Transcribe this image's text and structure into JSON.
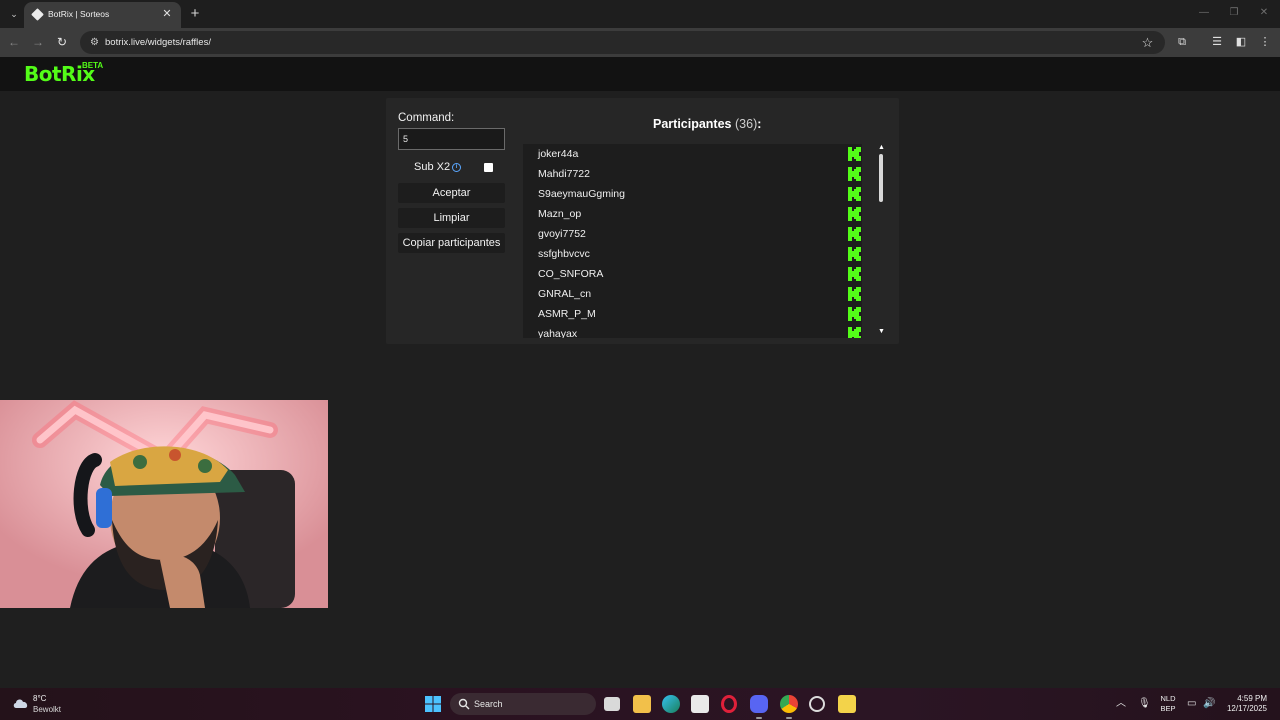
{
  "browser": {
    "tab_title": "BotRix | Sorteos",
    "url": "botrix.live/widgets/raffles/",
    "new_tab_symbol": "+",
    "close_symbol": "✕"
  },
  "site": {
    "logo": "BotRix",
    "beta": "BETA",
    "brand_color": "#53fc18"
  },
  "form": {
    "command_label": "Command:",
    "command_value": "5",
    "subx2_label": "Sub X2",
    "subx2_checked": false,
    "accept_label": "Aceptar",
    "clear_label": "Limpiar",
    "copy_label": "Copiar participantes"
  },
  "participants": {
    "title": "Participantes",
    "count": "(36)",
    "colon": ":",
    "names": [
      "joker44a",
      "Mahdi7722",
      "S9aeymauGgming",
      "Mazn_op",
      "gvoyi7752",
      "ssfghbvcvc",
      "CO_SNFORA",
      "GNRAL_cn",
      "ASMR_P_M",
      "yahayax"
    ],
    "platform_icon": "kick-icon"
  },
  "taskbar": {
    "temperature": "8°C",
    "weather": "Bewolkt",
    "search_label": "Search",
    "lang_line1": "NLD",
    "lang_line2": "BEP",
    "time": "4:59 PM",
    "date": "12/17/2025"
  }
}
